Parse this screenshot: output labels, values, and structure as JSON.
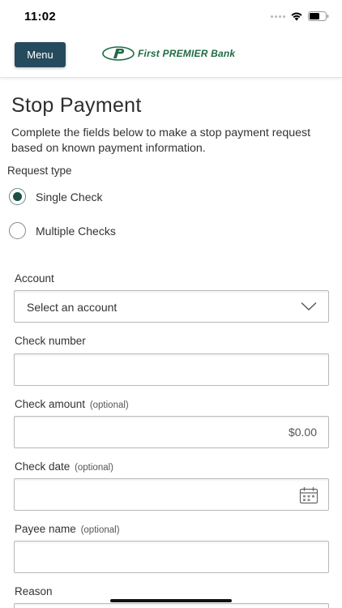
{
  "status": {
    "time": "11:02"
  },
  "header": {
    "menu_label": "Menu",
    "logo_text": "First PREMIER Bank"
  },
  "page": {
    "title": "Stop Payment",
    "description": "Complete the fields below to make a stop payment request based on known payment information."
  },
  "request_type": {
    "label": "Request type",
    "options": [
      {
        "label": "Single Check",
        "selected": true
      },
      {
        "label": "Multiple Checks",
        "selected": false
      }
    ]
  },
  "form": {
    "optional_text": "(optional)",
    "account": {
      "label": "Account",
      "value": "Select an account"
    },
    "check_number": {
      "label": "Check number",
      "value": ""
    },
    "check_amount": {
      "label": "Check amount",
      "value": "$0.00"
    },
    "check_date": {
      "label": "Check date",
      "value": ""
    },
    "payee_name": {
      "label": "Payee name",
      "value": ""
    },
    "reason": {
      "label": "Reason"
    }
  },
  "colors": {
    "menu_bg": "#254a5e",
    "logo_green": "#1f6b43",
    "radio_fill": "#1c5046"
  }
}
